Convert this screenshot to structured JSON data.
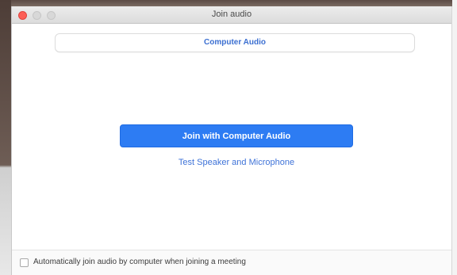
{
  "window": {
    "title": "Join audio"
  },
  "tabs": [
    {
      "label": "Computer Audio"
    }
  ],
  "main": {
    "join_button_label": "Join with Computer Audio",
    "test_link_label": "Test Speaker and Microphone"
  },
  "footer": {
    "auto_join_label": "Automatically join audio by computer when joining a meeting",
    "auto_join_checked": false
  },
  "colors": {
    "accent": "#2d7cf3",
    "link": "#3f73d8",
    "close_button": "#fd5f57"
  },
  "icons": {
    "close": "close-traffic-light-icon",
    "minimize": "minimize-traffic-light-icon",
    "maximize": "maximize-traffic-light-icon"
  }
}
